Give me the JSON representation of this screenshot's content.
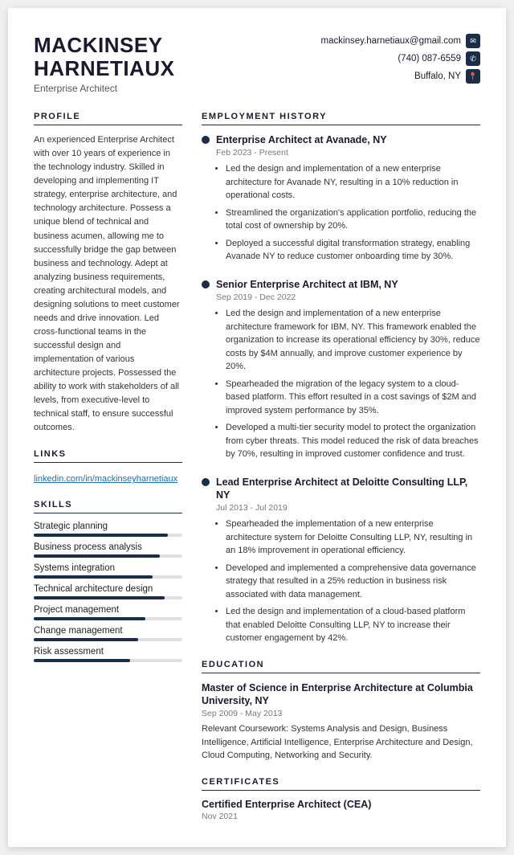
{
  "header": {
    "first_name": "MACKINSEY",
    "last_name": "HARNETIAUX",
    "title": "Enterprise Architect",
    "email": "mackinsey.harnetiaux@gmail.com",
    "phone": "(740) 087-6559",
    "location": "Buffalo, NY"
  },
  "profile": {
    "section_title": "PROFILE",
    "text": "An experienced Enterprise Architect with over 10 years of experience in the technology industry. Skilled in developing and implementing IT strategy, enterprise architecture, and technology architecture. Possess a unique blend of technical and business acumen, allowing me to successfully bridge the gap between business and technology. Adept at analyzing business requirements, creating architectural models, and designing solutions to meet customer needs and drive innovation. Led cross-functional teams in the successful design and implementation of various architecture projects. Possessed the ability to work with stakeholders of all levels, from executive-level to technical staff, to ensure successful outcomes."
  },
  "links": {
    "section_title": "LINKS",
    "linkedin": "linkedin.com/in/mackinseyharnetiaux"
  },
  "skills": {
    "section_title": "SKILLS",
    "items": [
      {
        "name": "Strategic planning",
        "level": 90
      },
      {
        "name": "Business process analysis",
        "level": 85
      },
      {
        "name": "Systems integration",
        "level": 80
      },
      {
        "name": "Technical architecture design",
        "level": 88
      },
      {
        "name": "Project management",
        "level": 75
      },
      {
        "name": "Change management",
        "level": 70
      },
      {
        "name": "Risk assessment",
        "level": 65
      }
    ]
  },
  "employment": {
    "section_title": "EMPLOYMENT HISTORY",
    "jobs": [
      {
        "title": "Enterprise Architect at Avanade, NY",
        "dates": "Feb 2023 - Present",
        "bullets": [
          "Led the design and implementation of a new enterprise architecture for Avanade NY, resulting in a 10% reduction in operational costs.",
          "Streamlined the organization's application portfolio, reducing the total cost of ownership by 20%.",
          "Deployed a successful digital transformation strategy, enabling Avanade NY to reduce customer onboarding time by 30%."
        ]
      },
      {
        "title": "Senior Enterprise Architect at IBM, NY",
        "dates": "Sep 2019 - Dec 2022",
        "bullets": [
          "Led the design and implementation of a new enterprise architecture framework for IBM, NY. This framework enabled the organization to increase its operational efficiency by 30%, reduce costs by $4M annually, and improve customer experience by 20%.",
          "Spearheaded the migration of the legacy system to a cloud-based platform. This effort resulted in a cost savings of $2M and improved system performance by 35%.",
          "Developed a multi-tier security model to protect the organization from cyber threats. This model reduced the risk of data breaches by 70%, resulting in improved customer confidence and trust."
        ]
      },
      {
        "title": "Lead Enterprise Architect at Deloitte Consulting LLP, NY",
        "dates": "Jul 2013 - Jul 2019",
        "bullets": [
          "Spearheaded the implementation of a new enterprise architecture system for Deloitte Consulting LLP, NY, resulting in an 18% improvement in operational efficiency.",
          "Developed and implemented a comprehensive data governance strategy that resulted in a 25% reduction in business risk associated with data management.",
          "Led the design and implementation of a cloud-based platform that enabled Deloitte Consulting LLP, NY to increase their customer engagement by 42%."
        ]
      }
    ]
  },
  "education": {
    "section_title": "EDUCATION",
    "degree": "Master of Science in Enterprise Architecture at Columbia University, NY",
    "dates": "Sep 2009 - May 2013",
    "coursework": "Relevant Coursework: Systems Analysis and Design, Business Intelligence, Artificial Intelligence, Enterprise Architecture and Design, Cloud Computing, Networking and Security."
  },
  "certificates": {
    "section_title": "CERTIFICATES",
    "items": [
      {
        "name": "Certified Enterprise Architect (CEA)",
        "date": "Nov 2021"
      }
    ]
  }
}
